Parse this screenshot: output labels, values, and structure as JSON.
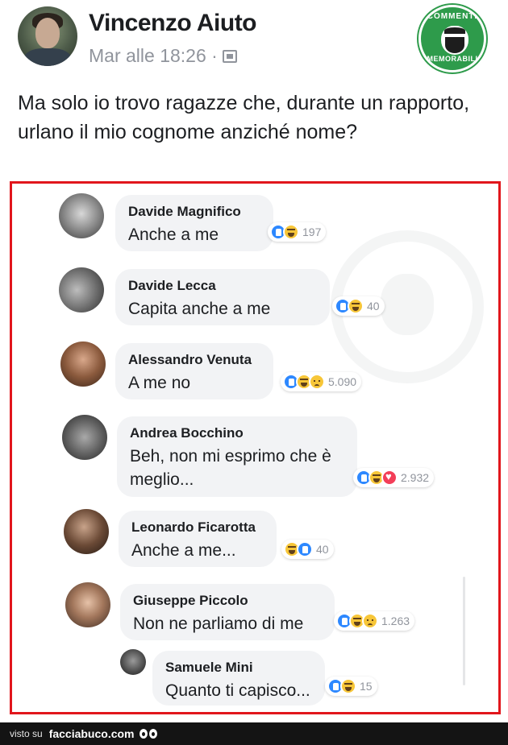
{
  "post": {
    "author": "Vincenzo Aiuto",
    "time": "Mar alle 18:26 ·",
    "text": "Ma solo io trovo ragazze che, durante un rapporto, urlano il mio cognome anziché nome?"
  },
  "badge": {
    "top_text": "COMMENTI",
    "bottom_text": "MEMORABILI"
  },
  "comments": [
    {
      "name": "Davide Magnifico",
      "text": "Anche a me",
      "reactions": [
        "like",
        "haha"
      ],
      "count": "197"
    },
    {
      "name": "Davide Lecca",
      "text": "Capita anche a me",
      "reactions": [
        "like",
        "haha"
      ],
      "count": "40"
    },
    {
      "name": "Alessandro Venuta",
      "text": "A me no",
      "reactions": [
        "like",
        "haha",
        "sad"
      ],
      "count": "5.090"
    },
    {
      "name": "Andrea Bocchino",
      "text": "Beh, non mi esprimo che è meglio...",
      "reactions": [
        "like",
        "haha",
        "love"
      ],
      "count": "2.932"
    },
    {
      "name": "Leonardo Ficarotta",
      "text": "Anche a me...",
      "reactions": [
        "haha",
        "like"
      ],
      "count": "40"
    },
    {
      "name": "Giuseppe Piccolo",
      "text": "Non ne parliamo di me",
      "reactions": [
        "like",
        "haha",
        "sad"
      ],
      "count": "1.263"
    },
    {
      "name": "Samuele Mini",
      "text": "Quanto ti capisco...",
      "reactions": [
        "like",
        "haha"
      ],
      "count": "15"
    }
  ],
  "colors": {
    "frame": "#e1161c",
    "like": "#2d88ff",
    "haha": "#f7c638",
    "love": "#f33e58",
    "badge": "#2e9b4b"
  },
  "footer": {
    "visto": "visto su",
    "brand": "facciabuco.com"
  }
}
